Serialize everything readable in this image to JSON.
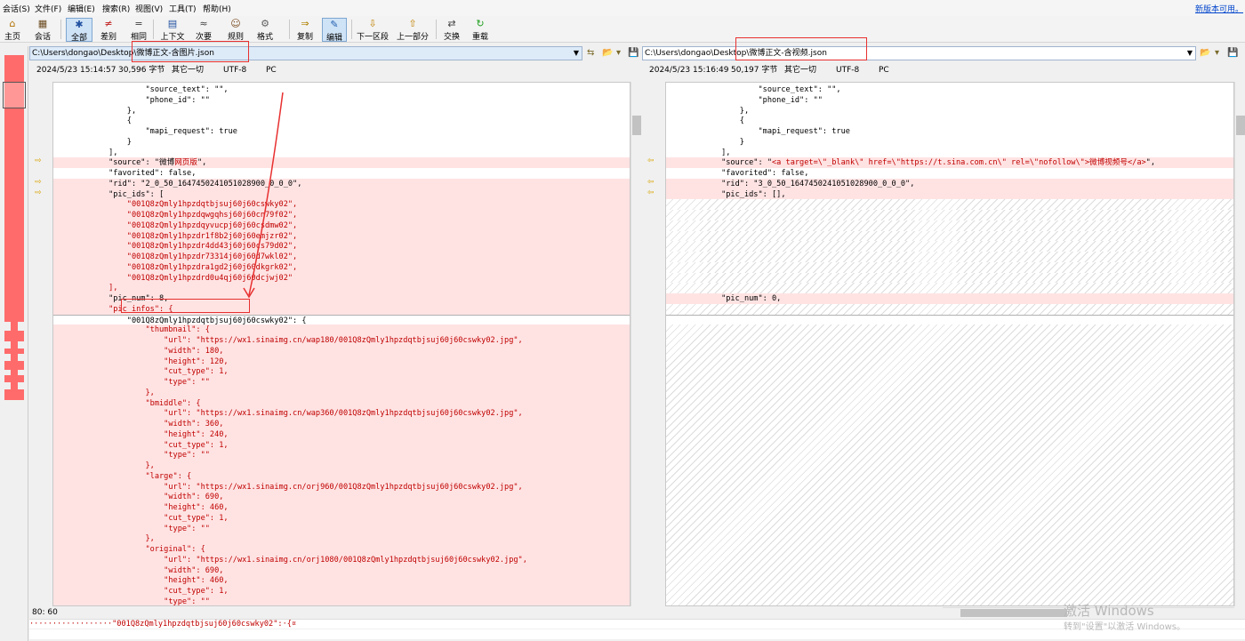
{
  "menu": [
    "会话(S)",
    "文件(F)",
    "编辑(E)",
    "搜索(R)",
    "视图(V)",
    "工具(T)",
    "帮助(H)"
  ],
  "new_version": "新版本可用。",
  "toolbar": [
    {
      "label": "主页",
      "icon": "home-icon",
      "glyph": "⌂"
    },
    {
      "label": "会话",
      "icon": "session-icon",
      "glyph": "▦"
    },
    {
      "label": "全部",
      "icon": "all-icon",
      "glyph": "✱"
    },
    {
      "label": "差别",
      "icon": "diff-icon",
      "glyph": "≠"
    },
    {
      "label": "相同",
      "icon": "same-icon",
      "glyph": "="
    },
    {
      "label": "上下文",
      "icon": "context-icon",
      "glyph": "▤"
    },
    {
      "label": "次要",
      "icon": "minor-icon",
      "glyph": "≈"
    },
    {
      "label": "规则",
      "icon": "rules-icon",
      "glyph": "☺"
    },
    {
      "label": "格式",
      "icon": "format-icon",
      "glyph": "⚙"
    },
    {
      "label": "复制",
      "icon": "copy-icon",
      "glyph": "⇒"
    },
    {
      "label": "编辑",
      "icon": "edit-icon",
      "glyph": "✎"
    },
    {
      "label": "下一区段",
      "icon": "next-section-icon",
      "glyph": "⇩"
    },
    {
      "label": "上一部分",
      "icon": "prev-section-icon",
      "glyph": "⇧"
    },
    {
      "label": "交换",
      "icon": "swap-icon",
      "glyph": "⇄"
    },
    {
      "label": "重载",
      "icon": "reload-icon",
      "glyph": "↻"
    }
  ],
  "left": {
    "path": "C:\\Users\\dongao\\Desktop\\微博正文-含图片.json",
    "date": "2024/5/23 15:14:57",
    "size": "30,596 字节",
    "other": "其它一切",
    "encoding": "UTF-8",
    "lineend": "PC",
    "lines": [
      {
        "t": "                    \"source_text\": \"\",",
        "k": "n"
      },
      {
        "t": "                    \"phone_id\": \"\"",
        "k": "n"
      },
      {
        "t": "                },",
        "k": "n"
      },
      {
        "t": "                {",
        "k": "n"
      },
      {
        "t": "                    \"mapi_request\": true",
        "k": "n"
      },
      {
        "t": "                }",
        "k": "n"
      },
      {
        "t": "            ],",
        "k": "n"
      },
      {
        "t": "            \"source\": \"微博",
        "r": "网页版",
        "e": "\",",
        "k": "h"
      },
      {
        "t": "            \"favorited\": false,",
        "k": "n"
      },
      {
        "t": "            \"rid\": \"2_0_50_1647450241051028900_0_0_0\",",
        "k": "h"
      },
      {
        "t": "            \"pic_ids\": [",
        "k": "h"
      },
      {
        "t": "                \"001Q8zQmly1hpzdqtbjsuj60j60cswky02\",",
        "k": "d"
      },
      {
        "t": "                \"001Q8zQmly1hpzdqwgqhsj60j60cn79f02\",",
        "k": "d"
      },
      {
        "t": "                \"001Q8zQmly1hpzdqyvucpj60j60csdmw02\",",
        "k": "d"
      },
      {
        "t": "                \"001Q8zQmly1hpzdr1f8b2j60j60emjzr02\",",
        "k": "d"
      },
      {
        "t": "                \"001Q8zQmly1hpzdr4dd43j60j60cs79d02\",",
        "k": "d"
      },
      {
        "t": "                \"001Q8zQmly1hpzdr73314j60j60d7wkl02\",",
        "k": "d"
      },
      {
        "t": "                \"001Q8zQmly1hpzdra1gd2j60j60dkgrk02\",",
        "k": "d"
      },
      {
        "t": "                \"001Q8zQmly1hpzdrd0u4qj60j60dcjwj02\"",
        "k": "d"
      },
      {
        "t": "            ],",
        "k": "d"
      },
      {
        "t": "            \"pic_num\": 8,",
        "k": "h"
      },
      {
        "t": "            \"pic_infos\": {",
        "k": "d"
      },
      {
        "t": "                \"001Q8zQmly1hpzdqtbjsuj60j60cswky02\": {",
        "k": "c"
      },
      {
        "t": "                    \"thumbnail\": {",
        "k": "d"
      },
      {
        "t": "                        \"url\": \"https://wx1.sinaimg.cn/wap180/001Q8zQmly1hpzdqtbjsuj60j60cswky02.jpg\",",
        "k": "d"
      },
      {
        "t": "                        \"width\": 180,",
        "k": "d"
      },
      {
        "t": "                        \"height\": 120,",
        "k": "d"
      },
      {
        "t": "                        \"cut_type\": 1,",
        "k": "d"
      },
      {
        "t": "                        \"type\": \"\"",
        "k": "d"
      },
      {
        "t": "                    },",
        "k": "d"
      },
      {
        "t": "                    \"bmiddle\": {",
        "k": "d"
      },
      {
        "t": "                        \"url\": \"https://wx1.sinaimg.cn/wap360/001Q8zQmly1hpzdqtbjsuj60j60cswky02.jpg\",",
        "k": "d"
      },
      {
        "t": "                        \"width\": 360,",
        "k": "d"
      },
      {
        "t": "                        \"height\": 240,",
        "k": "d"
      },
      {
        "t": "                        \"cut_type\": 1,",
        "k": "d"
      },
      {
        "t": "                        \"type\": \"\"",
        "k": "d"
      },
      {
        "t": "                    },",
        "k": "d"
      },
      {
        "t": "                    \"large\": {",
        "k": "d"
      },
      {
        "t": "                        \"url\": \"https://wx1.sinaimg.cn/orj960/001Q8zQmly1hpzdqtbjsuj60j60cswky02.jpg\",",
        "k": "d"
      },
      {
        "t": "                        \"width\": 690,",
        "k": "d"
      },
      {
        "t": "                        \"height\": 460,",
        "k": "d"
      },
      {
        "t": "                        \"cut_type\": 1,",
        "k": "d"
      },
      {
        "t": "                        \"type\": \"\"",
        "k": "d"
      },
      {
        "t": "                    },",
        "k": "d"
      },
      {
        "t": "                    \"original\": {",
        "k": "d"
      },
      {
        "t": "                        \"url\": \"https://wx1.sinaimg.cn/orj1080/001Q8zQmly1hpzdqtbjsuj60j60cswky02.jpg\",",
        "k": "d"
      },
      {
        "t": "                        \"width\": 690,",
        "k": "d"
      },
      {
        "t": "                        \"height\": 460,",
        "k": "d"
      },
      {
        "t": "                        \"cut_type\": 1,",
        "k": "d"
      },
      {
        "t": "                        \"type\": \"\"",
        "k": "d"
      }
    ]
  },
  "right": {
    "path": "C:\\Users\\dongao\\Desktop\\微博正文-含视频.json",
    "date": "2024/5/23 15:16:49",
    "size": "50,197 字节",
    "other": "其它一切",
    "encoding": "UTF-8",
    "lineend": "PC",
    "lines": [
      {
        "t": "                    \"source_text\": \"\",",
        "k": "n"
      },
      {
        "t": "                    \"phone_id\": \"\"",
        "k": "n"
      },
      {
        "t": "                },",
        "k": "n"
      },
      {
        "t": "                {",
        "k": "n"
      },
      {
        "t": "                    \"mapi_request\": true",
        "k": "n"
      },
      {
        "t": "                }",
        "k": "n"
      },
      {
        "t": "            ],",
        "k": "n"
      },
      {
        "t": "            \"source\": \"",
        "r": "<a target=\\\"_blank\\\" href=\\\"https://t.sina.com.cn\\\" rel=\\\"nofollow\\\">微博视频号</a>",
        "e": "\",",
        "k": "h"
      },
      {
        "t": "            \"favorited\": false,",
        "k": "n"
      },
      {
        "t": "            \"rid\": \"3_0_50_1647450241051028900_0_0_0\",",
        "k": "h"
      },
      {
        "t": "            \"pic_ids\": [],",
        "k": "h"
      },
      {
        "t": "",
        "k": "x"
      },
      {
        "t": "",
        "k": "x"
      },
      {
        "t": "",
        "k": "x"
      },
      {
        "t": "",
        "k": "x"
      },
      {
        "t": "",
        "k": "x"
      },
      {
        "t": "",
        "k": "x"
      },
      {
        "t": "",
        "k": "x"
      },
      {
        "t": "",
        "k": "x"
      },
      {
        "t": "",
        "k": "x"
      },
      {
        "t": "            \"pic_num\": 0,",
        "k": "h"
      },
      {
        "t": "",
        "k": "x"
      },
      {
        "t": "",
        "k": "c"
      }
    ]
  },
  "status": {
    "cursor": "80: 60"
  },
  "bottom_line": "··················\"001Q8zQmly1hpzdqtbjsuj60j60cswky02\":·{¤",
  "watermark": {
    "title": "激活 Windows",
    "sub": "转到\"设置\"以激活 Windows。"
  }
}
